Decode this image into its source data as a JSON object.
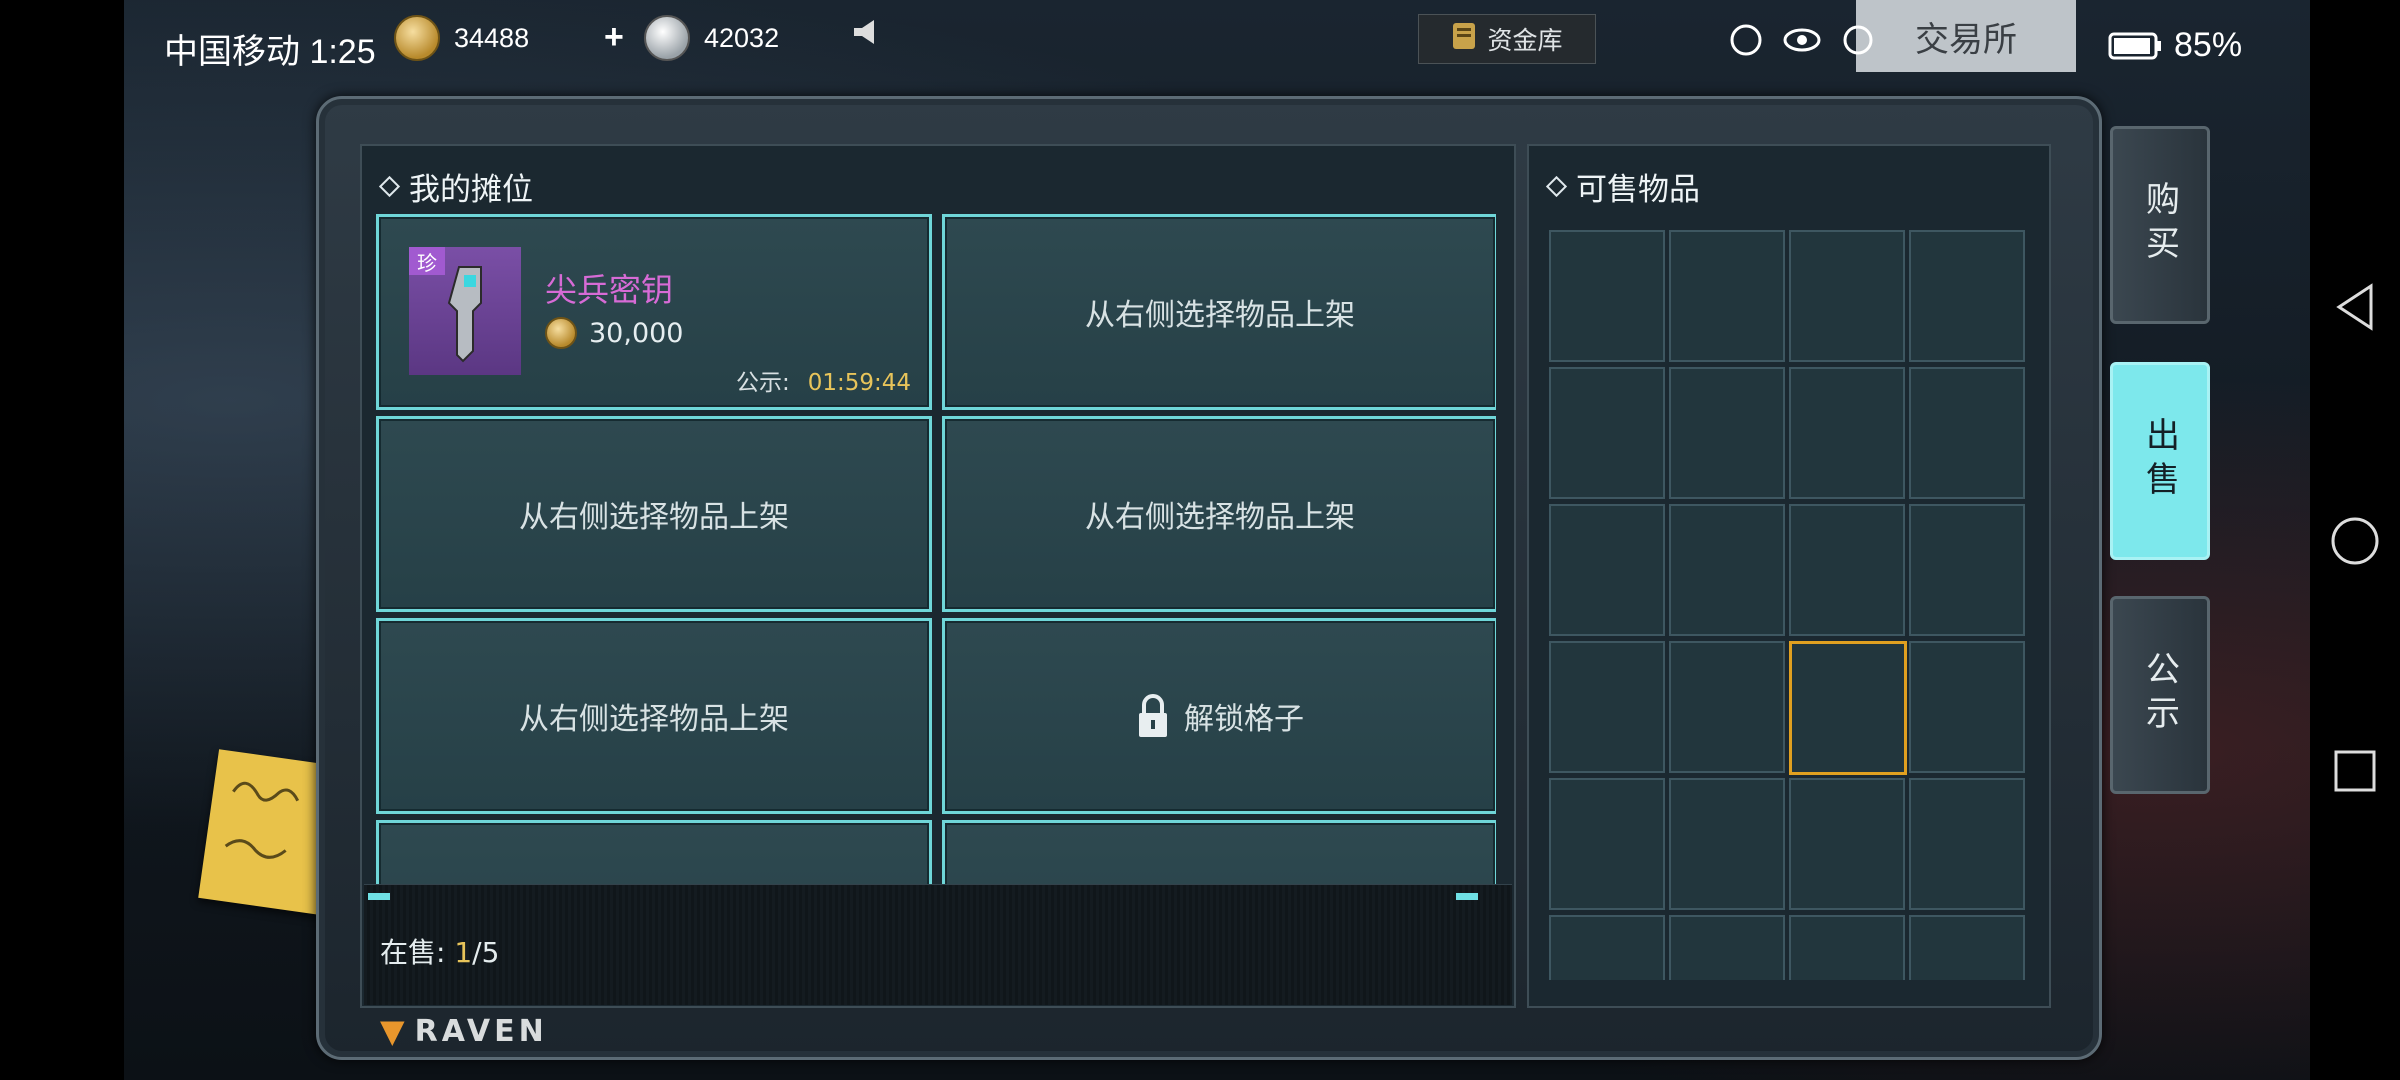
{
  "status_bar": {
    "carrier_time": "中国移动 1:25",
    "battery": "85%"
  },
  "currencies": [
    {
      "name": "gold-coin",
      "value": "34488"
    },
    {
      "name": "silver-coin",
      "value": "42032"
    }
  ],
  "add_currency_label": "+",
  "vault_button_label": "资金库",
  "trade_title": "交易所",
  "stall": {
    "title": "我的摊位",
    "slots": [
      {
        "type": "item",
        "badge": "珍",
        "name": "尖兵密钥",
        "price": "30,000",
        "timer_label": "公示:",
        "timer_value": "01:59:44"
      },
      {
        "type": "empty",
        "label": "从右侧选择物品上架"
      },
      {
        "type": "empty",
        "label": "从右侧选择物品上架"
      },
      {
        "type": "empty",
        "label": "从右侧选择物品上架"
      },
      {
        "type": "empty",
        "label": "从右侧选择物品上架"
      },
      {
        "type": "locked",
        "label": "解锁格子"
      }
    ],
    "on_sale_label": "在售:",
    "on_sale_current": "1",
    "on_sale_total": "/5"
  },
  "sellable": {
    "title": "可售物品",
    "selected_cell": {
      "row": 4,
      "col": 3
    }
  },
  "side_tabs": [
    {
      "label": "购买",
      "active": false
    },
    {
      "label": "出售",
      "active": true
    },
    {
      "label": "公示",
      "active": false
    }
  ],
  "brand": "RAVEN",
  "colors": {
    "accent_cyan": "#6fd6d8",
    "timer_gold": "#e8c45a",
    "item_purple": "#d76bd6",
    "selected_border": "#e0a020"
  }
}
